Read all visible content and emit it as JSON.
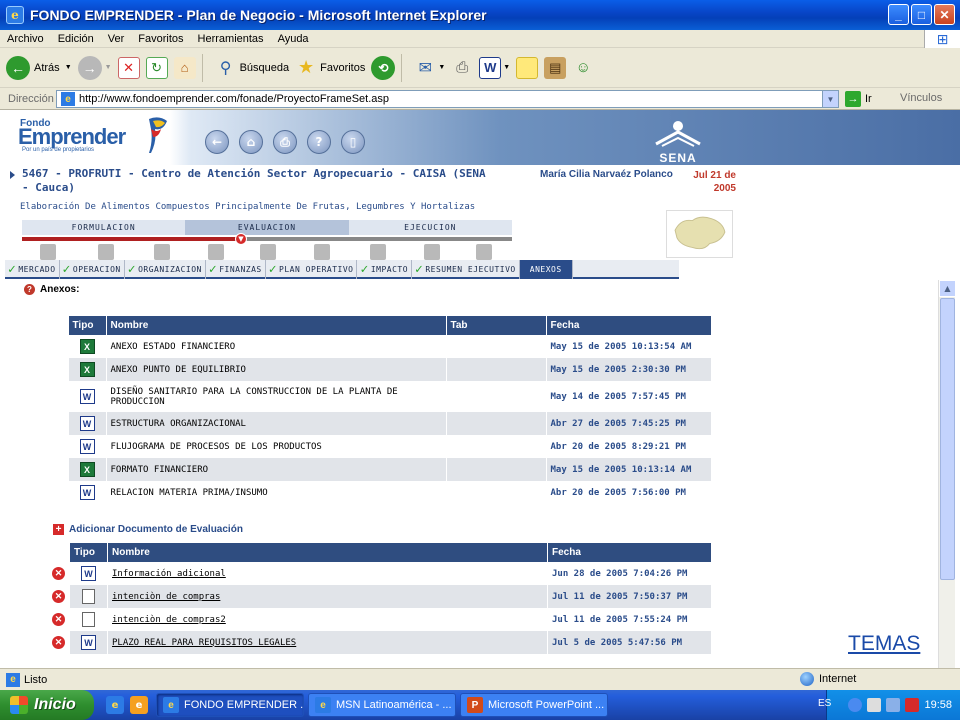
{
  "window": {
    "title": "FONDO EMPRENDER - Plan de Negocio - Microsoft Internet Explorer",
    "controls": {
      "minimize": "_",
      "maximize": "□",
      "close": "✕"
    }
  },
  "menu": [
    "Archivo",
    "Edición",
    "Ver",
    "Favoritos",
    "Herramientas",
    "Ayuda"
  ],
  "toolbar": {
    "back_label": "Atrás",
    "search_label": "Búsqueda",
    "favorites_label": "Favoritos"
  },
  "address": {
    "label": "Dirección",
    "url": "http://www.fondoemprender.com/fonade/ProyectoFrameSet.asp",
    "go_label": "Ir",
    "links_label": "Vínculos"
  },
  "banner": {
    "logo_top": "Fondo",
    "logo_main": "Emprender",
    "logo_tagline": "Por un país de propietarios",
    "sena_label": "SENA"
  },
  "project": {
    "title": "5467 - PROFRUTI - Centro de Atención Sector Agropecuario - CAISA (SENA - Cauca)",
    "user": "María Cilia Narvaéz Polanco",
    "date": "Jul 21 de 2005",
    "description": "Elaboración De Alimentos Compuestos Principalmente De Frutas, Legumbres Y Hortalizas"
  },
  "phases": [
    "FORMULACION",
    "EVALUACION",
    "EJECUCION"
  ],
  "tabs": [
    "MERCADO",
    "OPERACION",
    "ORGANIZACION",
    "FINANZAS",
    "PLAN OPERATIVO",
    "IMPACTO",
    "RESUMEN EJECUTIVO",
    "ANEXOS"
  ],
  "section_title": "Anexos:",
  "table1": {
    "headers": [
      "Tipo",
      "Nombre",
      "Tab",
      "Fecha"
    ],
    "rows": [
      {
        "type": "xls",
        "name": "ANEXO ESTADO FINANCIERO",
        "tab": "",
        "date": "May 15 de 2005 10:13:54 AM"
      },
      {
        "type": "xls",
        "name": "ANEXO PUNTO DE EQUILIBRIO",
        "tab": "",
        "date": "May 15 de 2005 2:30:30 PM"
      },
      {
        "type": "doc",
        "name": "DISEÑO SANITARIO PARA LA CONSTRUCCION DE LA PLANTA DE PRODUCCION",
        "tab": "",
        "date": "May 14 de 2005 7:57:45 PM"
      },
      {
        "type": "doc",
        "name": "ESTRUCTURA ORGANIZACIONAL",
        "tab": "",
        "date": "Abr 27 de 2005 7:45:25 PM"
      },
      {
        "type": "doc",
        "name": "FLUJOGRAMA DE PROCESOS DE LOS PRODUCTOS",
        "tab": "",
        "date": "Abr 20 de 2005 8:29:21 PM"
      },
      {
        "type": "xls",
        "name": "FORMATO FINANCIERO",
        "tab": "",
        "date": "May 15 de 2005 10:13:14 AM"
      },
      {
        "type": "doc",
        "name": "RELACION MATERIA PRIMA/INSUMO",
        "tab": "",
        "date": "Abr 20 de 2005 7:56:00 PM"
      }
    ]
  },
  "add_document_label": "Adicionar Documento de Evaluación",
  "table2": {
    "headers": [
      "Tipo",
      "Nombre",
      "Fecha"
    ],
    "rows": [
      {
        "type": "doc",
        "name": "Información adicional",
        "date": "Jun 28 de 2005 7:04:26 PM"
      },
      {
        "type": "txt",
        "name": "intenciòn de compras",
        "date": "Jul 11 de 2005 7:50:37 PM"
      },
      {
        "type": "txt",
        "name": "intenciòn de compras2",
        "date": "Jul 11 de 2005 7:55:24 PM"
      },
      {
        "type": "doc",
        "name": "PLAZO REAL PARA REQUISITOS LEGALES",
        "date": "Jul 5 de 2005 5:47:56 PM"
      }
    ]
  },
  "overlay_link": "TEMAS",
  "status": {
    "text": "Listo",
    "zone": "Internet"
  },
  "taskbar": {
    "start_label": "Inicio",
    "tasks": [
      "FONDO EMPRENDER ...",
      "MSN Latinoamérica - ...",
      "Microsoft PowerPoint ..."
    ],
    "lang": "ES",
    "clock": "19:58"
  }
}
